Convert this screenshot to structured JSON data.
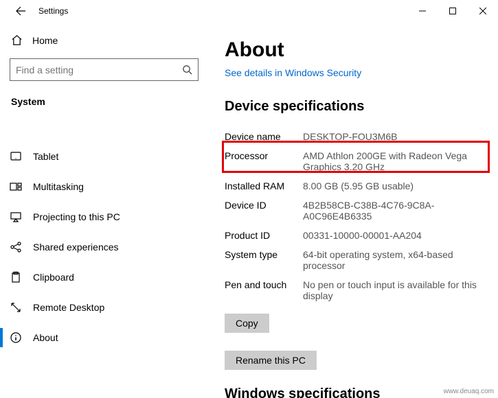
{
  "window": {
    "title": "Settings"
  },
  "sidebar": {
    "home_label": "Home",
    "search_placeholder": "Find a setting",
    "heading": "System",
    "items": [
      {
        "label": "Tablet"
      },
      {
        "label": "Multitasking"
      },
      {
        "label": "Projecting to this PC"
      },
      {
        "label": "Shared experiences"
      },
      {
        "label": "Clipboard"
      },
      {
        "label": "Remote Desktop"
      },
      {
        "label": "About"
      }
    ]
  },
  "about": {
    "title": "About",
    "security_link": "See details in Windows Security",
    "device_spec_heading": "Device specifications",
    "specs": {
      "device_name_label": "Device name",
      "device_name_value": "DESKTOP-FOU3M6B",
      "processor_label": "Processor",
      "processor_value": "AMD Athlon 200GE with Radeon Vega Graphics       3.20 GHz",
      "ram_label": "Installed RAM",
      "ram_value": "8.00 GB (5.95 GB usable)",
      "deviceid_label": "Device ID",
      "deviceid_value": "4B2B58CB-C38B-4C76-9C8A-A0C96E4B6335",
      "productid_label": "Product ID",
      "productid_value": "00331-10000-00001-AA204",
      "systype_label": "System type",
      "systype_value": "64-bit operating system, x64-based processor",
      "pentouch_label": "Pen and touch",
      "pentouch_value": "No pen or touch input is available for this display"
    },
    "copy_label": "Copy",
    "rename_label": "Rename this PC",
    "windows_spec_heading": "Windows specifications"
  },
  "watermark": "www.deuaq.com"
}
